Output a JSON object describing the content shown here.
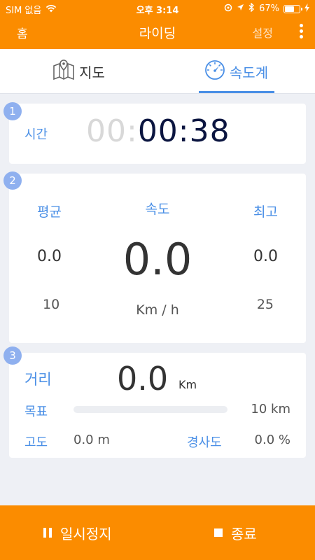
{
  "status_bar": {
    "carrier": "SIM 없음",
    "time": "오후 3:14",
    "battery_text": "67%",
    "battery_level": 0.67
  },
  "navbar": {
    "home": "홈",
    "title": "라이딩",
    "settings": "설정"
  },
  "tabs": [
    {
      "label": "지도",
      "icon": "map-icon",
      "active": false
    },
    {
      "label": "속도계",
      "icon": "speedometer-icon",
      "active": true
    }
  ],
  "card_time": {
    "badge": "1",
    "label": "시간",
    "hours": "00:",
    "value": "00:38"
  },
  "card_speed": {
    "badge": "2",
    "avg_label": "평균",
    "speed_label": "속도",
    "max_label": "최고",
    "avg": "0.0",
    "speed": "0.0",
    "max": "0.0",
    "avg_limit": "10",
    "unit": "Km / h",
    "max_limit": "25"
  },
  "card_distance": {
    "badge": "3",
    "distance_label": "거리",
    "distance": "0.0",
    "distance_unit": "Km",
    "goal_label": "목표",
    "goal_progress": 0.0,
    "goal": "10 km",
    "altitude_label": "고도",
    "altitude": "0.0 m",
    "grade_label": "경사도",
    "grade": "0.0 %"
  },
  "bottom_bar": {
    "pause": "일시정지",
    "stop": "종료"
  },
  "colors": {
    "accent": "#fb8c00",
    "blue": "#4a8fe6",
    "badge": "#8fb0ef"
  }
}
